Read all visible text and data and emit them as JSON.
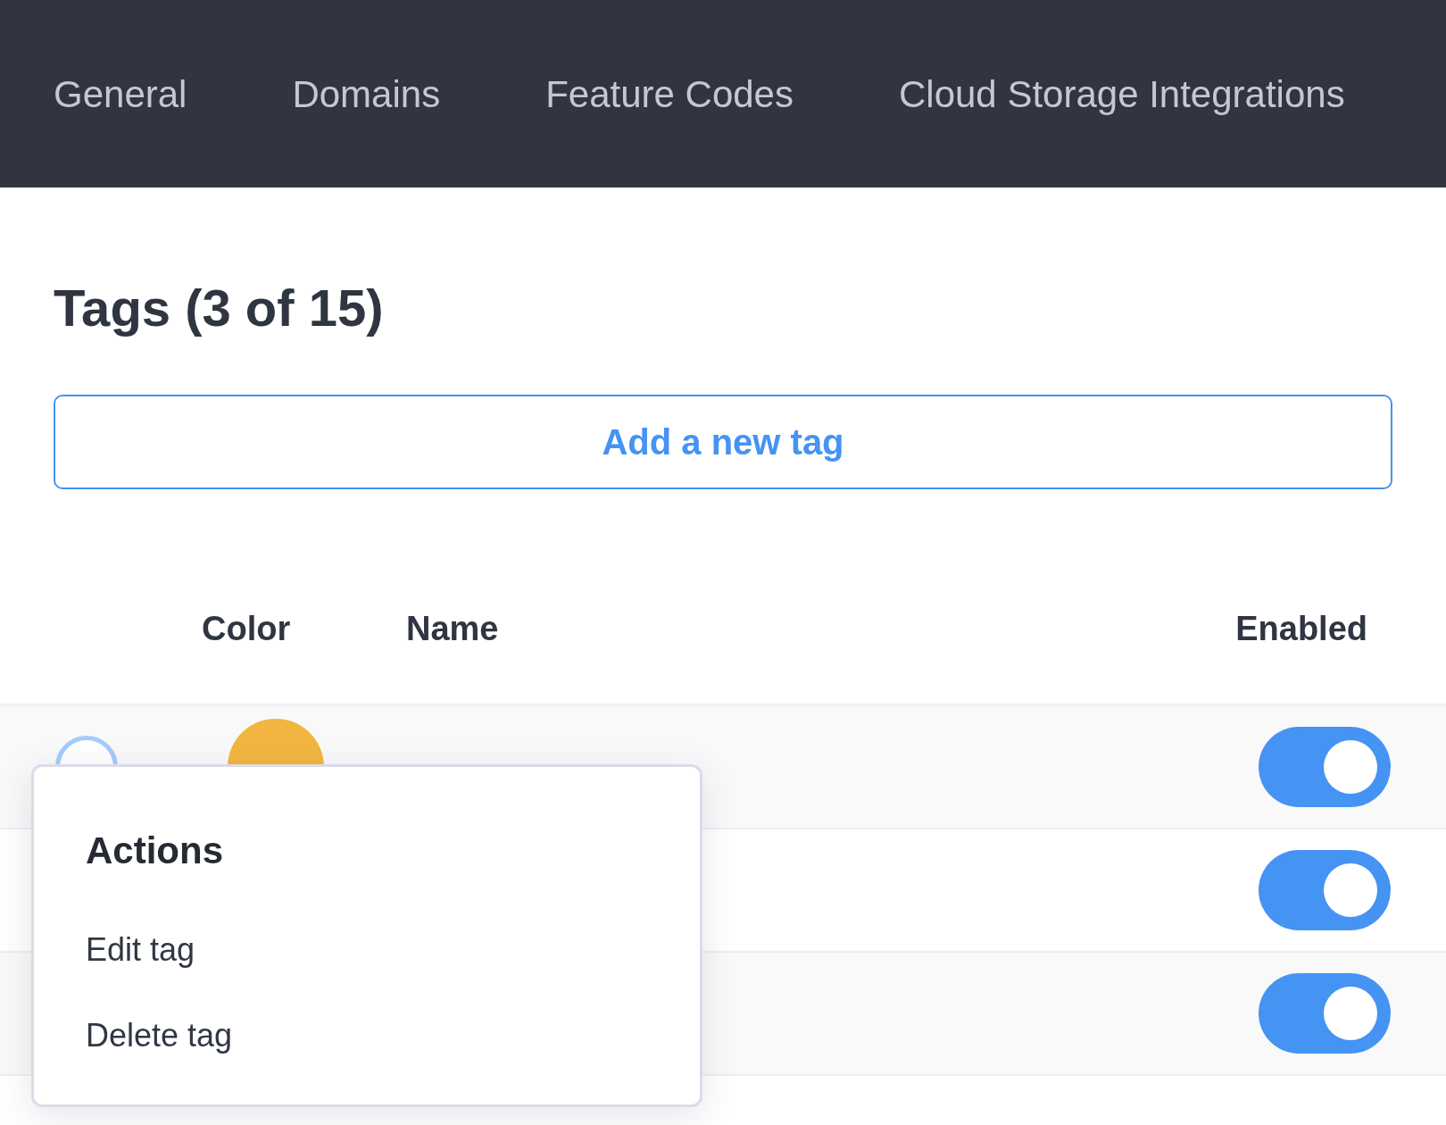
{
  "tabs": [
    {
      "label": "General",
      "selected": false
    },
    {
      "label": "Domains",
      "selected": false
    },
    {
      "label": "Feature Codes",
      "selected": false
    },
    {
      "label": "Cloud Storage Integrations",
      "selected": false
    }
  ],
  "title": "Tags (3 of 15)",
  "add_button": "Add a new tag",
  "table": {
    "columns": [
      {
        "label": "Color"
      },
      {
        "label": "Name"
      },
      {
        "label": "Enabled"
      }
    ],
    "rows": [
      {
        "selected": false,
        "color": "#f2b640",
        "enabled": true
      },
      {
        "enabled": true
      },
      {
        "enabled": true
      }
    ]
  },
  "menu": {
    "title": "Actions",
    "items": [
      "Edit tag",
      "Delete tag"
    ]
  }
}
